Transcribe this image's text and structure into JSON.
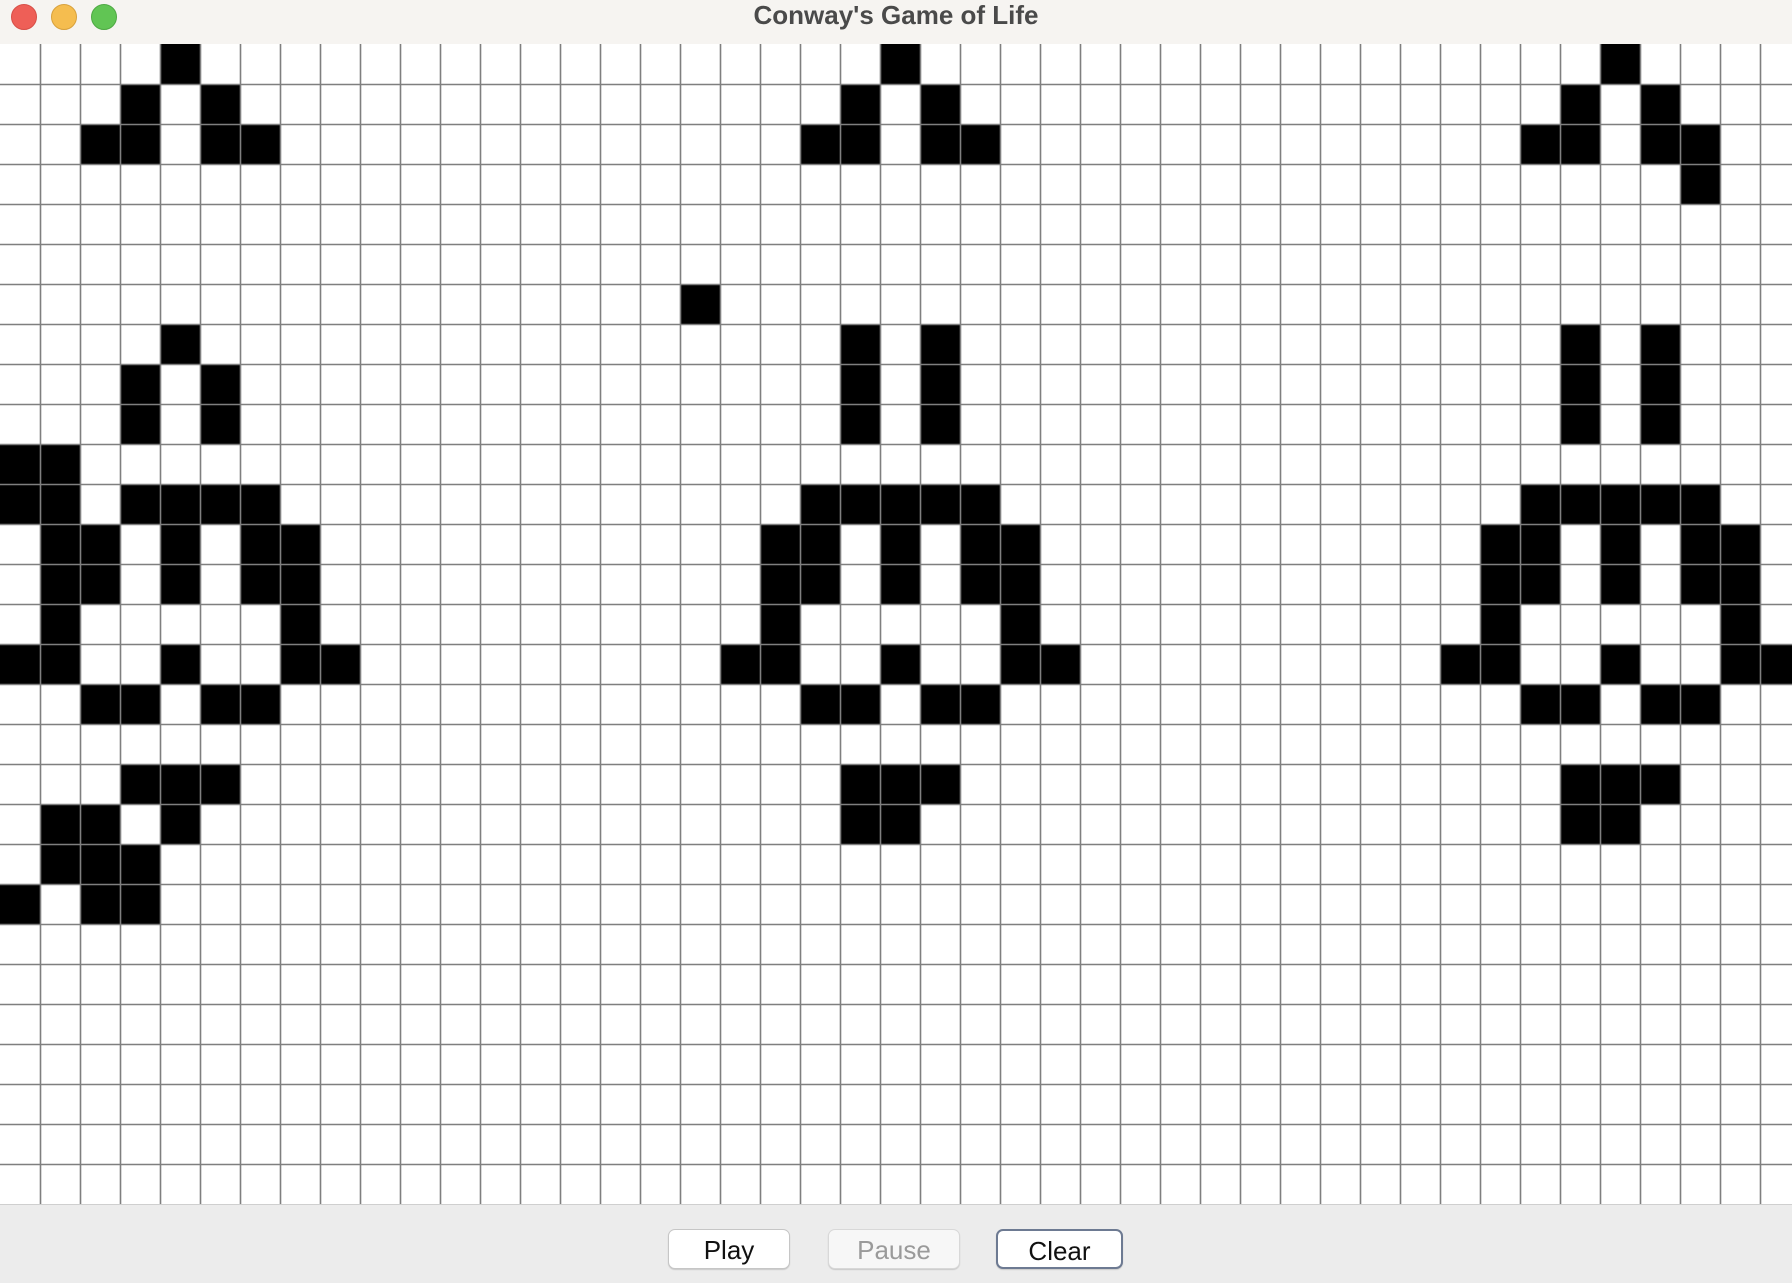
{
  "window": {
    "title": "Conway's Game of Life"
  },
  "grid": {
    "columns": 45,
    "rows": 29,
    "cell_state_colors": {
      "alive": "#000000",
      "dead": "#ffffff",
      "gridline": "#7f7f7f"
    },
    "alive_cells": [
      [
        4,
        0
      ],
      [
        22,
        0
      ],
      [
        40,
        0
      ],
      [
        3,
        1
      ],
      [
        5,
        1
      ],
      [
        21,
        1
      ],
      [
        23,
        1
      ],
      [
        39,
        1
      ],
      [
        41,
        1
      ],
      [
        2,
        2
      ],
      [
        3,
        2
      ],
      [
        5,
        2
      ],
      [
        6,
        2
      ],
      [
        20,
        2
      ],
      [
        21,
        2
      ],
      [
        23,
        2
      ],
      [
        24,
        2
      ],
      [
        38,
        2
      ],
      [
        39,
        2
      ],
      [
        41,
        2
      ],
      [
        42,
        2
      ],
      [
        42,
        3
      ],
      [
        17,
        6
      ],
      [
        4,
        7
      ],
      [
        21,
        7
      ],
      [
        23,
        7
      ],
      [
        39,
        7
      ],
      [
        41,
        7
      ],
      [
        3,
        8
      ],
      [
        5,
        8
      ],
      [
        21,
        8
      ],
      [
        23,
        8
      ],
      [
        39,
        8
      ],
      [
        41,
        8
      ],
      [
        3,
        9
      ],
      [
        5,
        9
      ],
      [
        21,
        9
      ],
      [
        23,
        9
      ],
      [
        39,
        9
      ],
      [
        41,
        9
      ],
      [
        0,
        10
      ],
      [
        1,
        10
      ],
      [
        0,
        11
      ],
      [
        1,
        11
      ],
      [
        3,
        11
      ],
      [
        4,
        11
      ],
      [
        5,
        11
      ],
      [
        6,
        11
      ],
      [
        20,
        11
      ],
      [
        21,
        11
      ],
      [
        22,
        11
      ],
      [
        23,
        11
      ],
      [
        24,
        11
      ],
      [
        38,
        11
      ],
      [
        39,
        11
      ],
      [
        40,
        11
      ],
      [
        41,
        11
      ],
      [
        42,
        11
      ],
      [
        1,
        12
      ],
      [
        2,
        12
      ],
      [
        4,
        12
      ],
      [
        6,
        12
      ],
      [
        7,
        12
      ],
      [
        19,
        12
      ],
      [
        20,
        12
      ],
      [
        22,
        12
      ],
      [
        24,
        12
      ],
      [
        25,
        12
      ],
      [
        37,
        12
      ],
      [
        38,
        12
      ],
      [
        40,
        12
      ],
      [
        42,
        12
      ],
      [
        43,
        12
      ],
      [
        1,
        13
      ],
      [
        2,
        13
      ],
      [
        4,
        13
      ],
      [
        6,
        13
      ],
      [
        7,
        13
      ],
      [
        19,
        13
      ],
      [
        20,
        13
      ],
      [
        22,
        13
      ],
      [
        24,
        13
      ],
      [
        25,
        13
      ],
      [
        37,
        13
      ],
      [
        38,
        13
      ],
      [
        40,
        13
      ],
      [
        42,
        13
      ],
      [
        43,
        13
      ],
      [
        1,
        14
      ],
      [
        7,
        14
      ],
      [
        19,
        14
      ],
      [
        25,
        14
      ],
      [
        37,
        14
      ],
      [
        43,
        14
      ],
      [
        0,
        15
      ],
      [
        1,
        15
      ],
      [
        4,
        15
      ],
      [
        7,
        15
      ],
      [
        8,
        15
      ],
      [
        18,
        15
      ],
      [
        19,
        15
      ],
      [
        22,
        15
      ],
      [
        25,
        15
      ],
      [
        26,
        15
      ],
      [
        36,
        15
      ],
      [
        37,
        15
      ],
      [
        40,
        15
      ],
      [
        43,
        15
      ],
      [
        44,
        15
      ],
      [
        2,
        16
      ],
      [
        3,
        16
      ],
      [
        5,
        16
      ],
      [
        6,
        16
      ],
      [
        20,
        16
      ],
      [
        21,
        16
      ],
      [
        23,
        16
      ],
      [
        24,
        16
      ],
      [
        38,
        16
      ],
      [
        39,
        16
      ],
      [
        41,
        16
      ],
      [
        42,
        16
      ],
      [
        3,
        18
      ],
      [
        4,
        18
      ],
      [
        5,
        18
      ],
      [
        21,
        18
      ],
      [
        22,
        18
      ],
      [
        23,
        18
      ],
      [
        39,
        18
      ],
      [
        40,
        18
      ],
      [
        41,
        18
      ],
      [
        1,
        19
      ],
      [
        2,
        19
      ],
      [
        4,
        19
      ],
      [
        21,
        19
      ],
      [
        22,
        19
      ],
      [
        39,
        19
      ],
      [
        40,
        19
      ],
      [
        1,
        20
      ],
      [
        2,
        20
      ],
      [
        3,
        20
      ],
      [
        0,
        21
      ],
      [
        2,
        21
      ],
      [
        3,
        21
      ]
    ]
  },
  "controls": {
    "play_label": "Play",
    "pause_label": "Pause",
    "clear_label": "Clear"
  }
}
